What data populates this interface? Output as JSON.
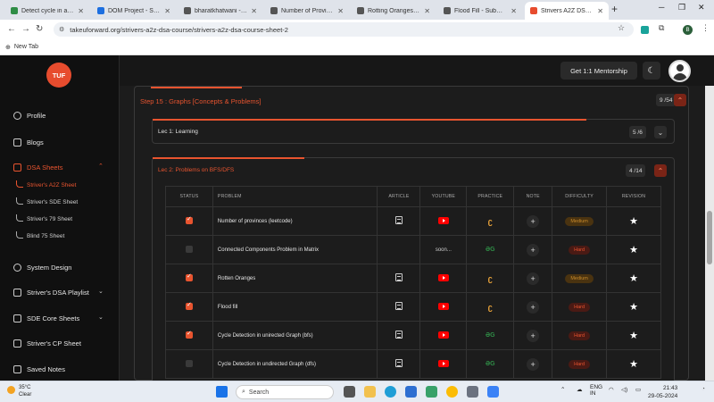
{
  "browser": {
    "tabs": [
      {
        "title": "Detect cycle in an un",
        "favicon_color": "#2f8d46",
        "active": false
      },
      {
        "title": "DOM Project - Stackb",
        "favicon_color": "#1d6fe0",
        "active": false
      },
      {
        "title": "bharatkhatwani - Lee",
        "favicon_color": "#555555",
        "active": false
      },
      {
        "title": "Number of Provinces",
        "favicon_color": "#555555",
        "active": false
      },
      {
        "title": "Rotting Oranges - Le",
        "favicon_color": "#555555",
        "active": false
      },
      {
        "title": "Flood Fill - Submissi",
        "favicon_color": "#555555",
        "active": false
      },
      {
        "title": "Strivers A2Z DSA Co",
        "favicon_color": "#e74c2e",
        "active": true
      }
    ],
    "url": "takeuforward.org/strivers-a2z-dsa-course/strivers-a2z-dsa-course-sheet-2",
    "bookmark_new_tab": "New Tab",
    "profile_initial": "B"
  },
  "sidebar": {
    "logo_text": "TUF",
    "items": {
      "profile": "Profile",
      "blogs": "Blogs",
      "dsa_sheets": "DSA Sheets",
      "system_design": "System Design",
      "playlist": "Striver's DSA Playlist",
      "sde_core": "SDE Core Sheets",
      "cp_sheet": "Striver's CP Sheet",
      "saved_notes": "Saved Notes"
    },
    "sub_items": {
      "a2z": "Striver's A2Z Sheet",
      "sde": "Striver's SDE Sheet",
      "s79": "Striver's 79 Sheet",
      "blind": "Blind 75 Sheet"
    }
  },
  "header": {
    "mentorship_label": "Get 1:1 Mentorship"
  },
  "step": {
    "title": "Step 15 : Graphs [Concepts & Problems]",
    "count": "9 /54",
    "progress": 0.17
  },
  "lectures": [
    {
      "title": "Lec 1: Learning",
      "count": "5 /6",
      "progress": 0.83
    },
    {
      "title": "Lec 2: Problems on BFS/DFS",
      "count": "4 /14",
      "progress": 0.29
    }
  ],
  "table": {
    "headers": [
      "STATUS",
      "PROBLEM",
      "ARTICLE",
      "YOUTUBE",
      "PRACTICE",
      "NOTE",
      "DIFFICULTY",
      "REVISION"
    ],
    "rows": [
      {
        "done": true,
        "problem": "Number of provinces (leetcode)",
        "article": true,
        "youtube": "video",
        "practice": "leetcode",
        "difficulty": "Medium"
      },
      {
        "done": false,
        "problem": "Connected Components Problem in Matrix",
        "article": false,
        "youtube": "soon...",
        "practice": "gfg",
        "difficulty": "Hard"
      },
      {
        "done": true,
        "problem": "Rotten Oranges",
        "article": true,
        "youtube": "video",
        "practice": "leetcode",
        "difficulty": "Medium"
      },
      {
        "done": true,
        "problem": "Flood fill",
        "article": true,
        "youtube": "video",
        "practice": "leetcode",
        "difficulty": "Hard"
      },
      {
        "done": true,
        "problem": "Cycle Detection in unirected Graph (bfs)",
        "article": true,
        "youtube": "video",
        "practice": "gfg",
        "difficulty": "Hard"
      },
      {
        "done": false,
        "problem": "Cycle Detection in undirected Graph (dfs)",
        "article": true,
        "youtube": "video",
        "practice": "gfg",
        "difficulty": "Hard"
      }
    ]
  },
  "taskbar": {
    "temp": "35°C",
    "weather": "Clear",
    "search_placeholder": "Search",
    "lang_top": "ENG",
    "lang_bottom": "IN",
    "time": "21:43",
    "date": "29-05-2024"
  }
}
